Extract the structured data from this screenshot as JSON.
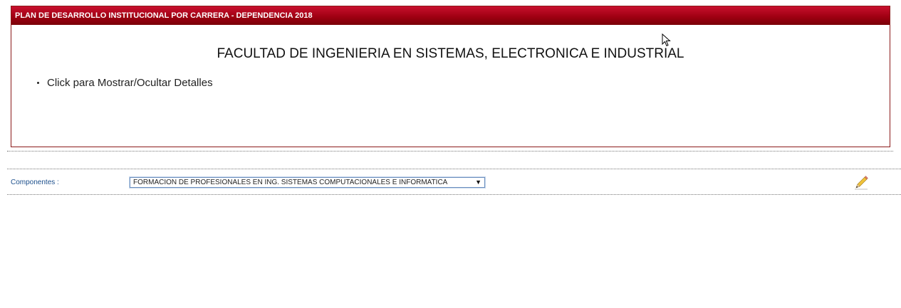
{
  "panel": {
    "header_title": "PLAN DE DESARROLLO INSTITUCIONAL POR CARRERA - DEPENDENCIA 2018",
    "faculty_title": "FACULTAD DE INGENIERIA EN SISTEMAS, ELECTRONICA E INDUSTRIAL",
    "details_toggle": "Click para Mostrar/Ocultar Detalles"
  },
  "components": {
    "label": "Componentes :",
    "selected": "FORMACION DE PROFESIONALES EN ING. SISTEMAS COMPUTACIONALES E INFORMATICA",
    "arrow": "▼",
    "edit_icon": "pencil-icon"
  },
  "colors": {
    "header_bg": "#a00012",
    "panel_border": "#8b1a1a",
    "label_blue": "#1c4f8c"
  }
}
